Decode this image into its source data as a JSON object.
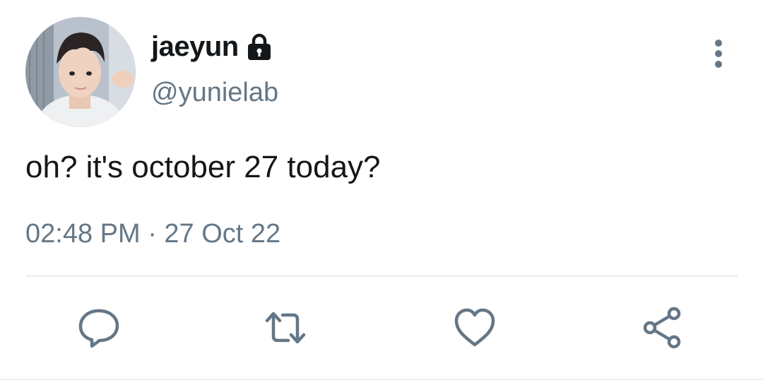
{
  "tweet": {
    "display_name": "jaeyun",
    "handle": "@yunielab",
    "text": "oh? it's october 27 today?",
    "timestamp": "02:48 PM · 27 Oct 22",
    "account_protected_icon": "lock-icon",
    "avatar": "profile-photo"
  },
  "actions": [
    {
      "name": "reply",
      "icon": "speech-bubble-icon"
    },
    {
      "name": "retweet",
      "icon": "retweet-icon"
    },
    {
      "name": "like",
      "icon": "heart-icon"
    },
    {
      "name": "share",
      "icon": "share-icon"
    }
  ],
  "menu": {
    "icon": "vertical-ellipsis-icon"
  },
  "colors": {
    "text_primary": "#14171a",
    "text_secondary": "#657786",
    "icon": "#657786",
    "divider": "#e6ecf0"
  }
}
